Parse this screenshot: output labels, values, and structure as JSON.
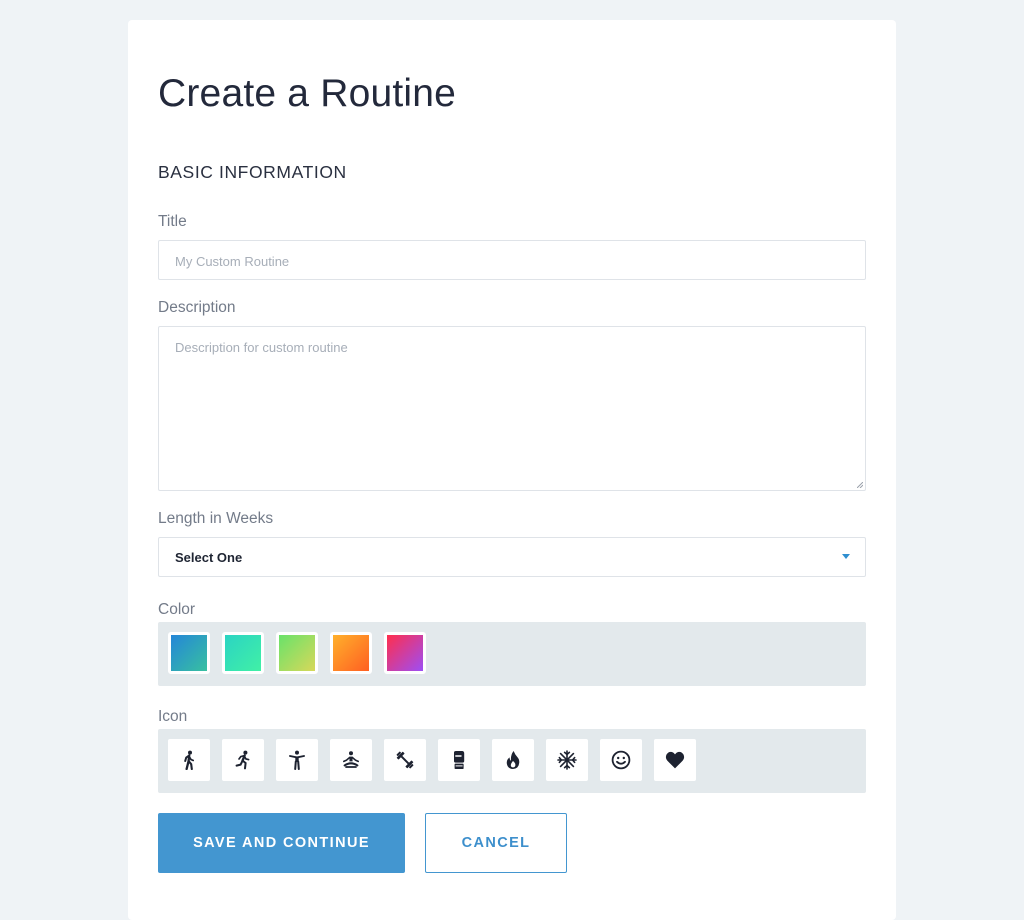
{
  "page": {
    "title": "Create a Routine"
  },
  "section": {
    "title": "BASIC INFORMATION"
  },
  "fields": {
    "title": {
      "label": "Title",
      "placeholder": "My Custom Routine"
    },
    "description": {
      "label": "Description",
      "placeholder": "Description for custom routine"
    },
    "length": {
      "label": "Length in Weeks",
      "selected": "Select One"
    }
  },
  "color": {
    "label": "Color",
    "swatches": [
      {
        "name": "blue-teal",
        "from": "#2486d8",
        "to": "#38c0a0"
      },
      {
        "name": "aqua",
        "from": "#2bd4c3",
        "to": "#41f0a6"
      },
      {
        "name": "lime",
        "from": "#69e26a",
        "to": "#d7d85a"
      },
      {
        "name": "orange",
        "from": "#ffb02b",
        "to": "#ff5f22"
      },
      {
        "name": "red-violet",
        "from": "#ff2e4c",
        "to": "#9d4ef5"
      }
    ]
  },
  "icon": {
    "label": "Icon",
    "items": [
      "walking-icon",
      "running-icon",
      "stretching-icon",
      "meditation-icon",
      "dumbbell-icon",
      "boxing-glove-icon",
      "fire-icon",
      "snowflake-icon",
      "smile-icon",
      "heart-icon"
    ]
  },
  "actions": {
    "save_label": "SAVE AND CONTINUE",
    "cancel_label": "CANCEL"
  },
  "colors": {
    "accent": "#4396d0",
    "background": "#eff3f6",
    "picker_bg": "#e3e9ec",
    "icon_color": "#1d2230"
  }
}
